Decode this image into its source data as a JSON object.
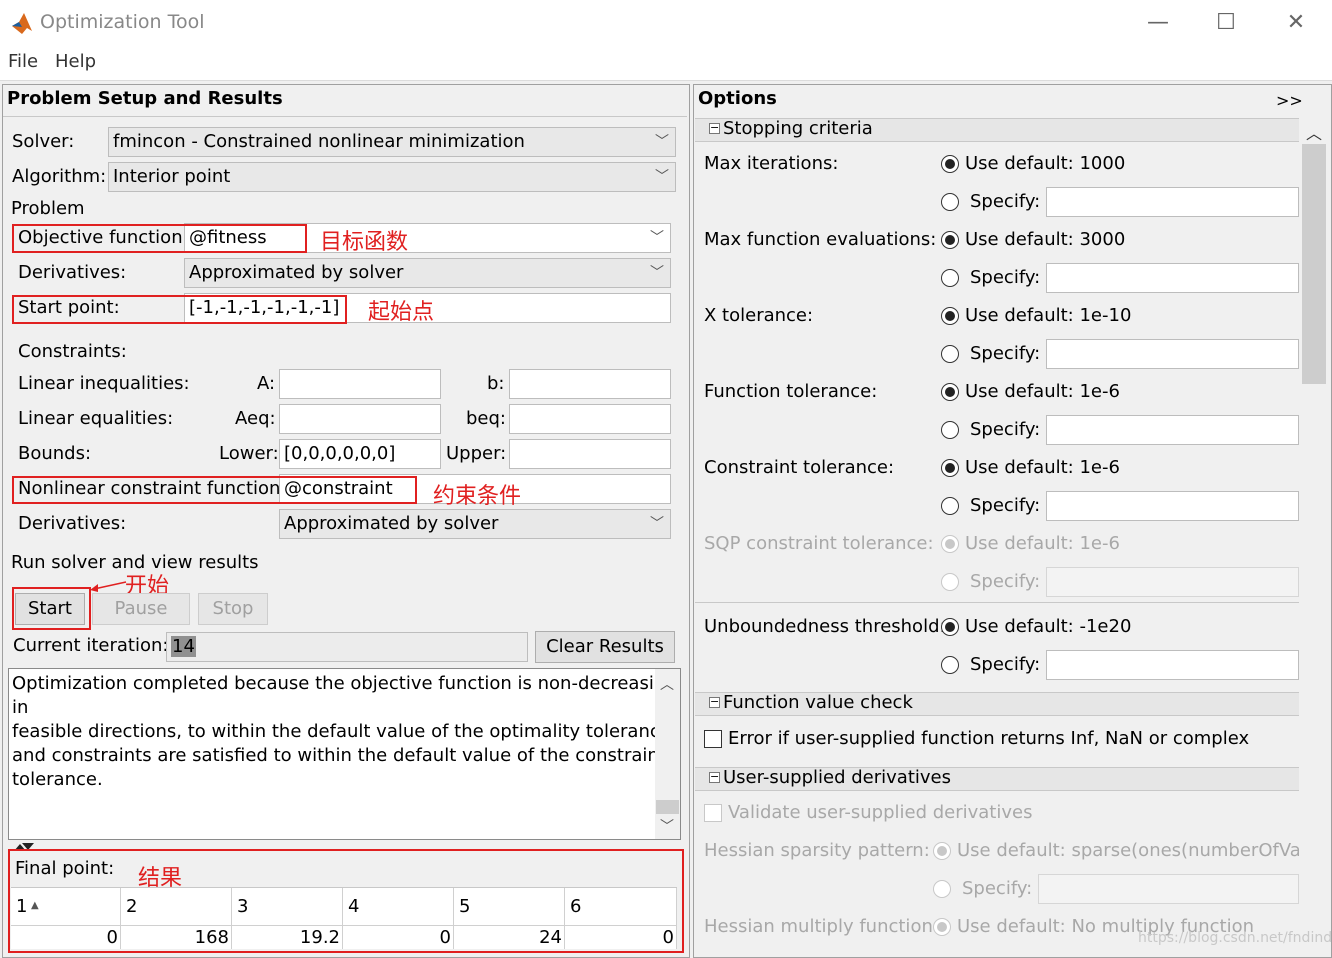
{
  "window": {
    "title": "Optimization Tool",
    "min": "—",
    "max": "☐",
    "close": "✕"
  },
  "menu": {
    "file": "File",
    "help": "Help"
  },
  "left": {
    "header": "Problem Setup and Results",
    "solver_label": "Solver:",
    "solver_value": "fmincon - Constrained nonlinear minimization",
    "algorithm_label": "Algorithm:",
    "algorithm_value": "Interior point",
    "problem_label": "Problem",
    "objective_label": "Objective function:",
    "objective_value": "@fitness",
    "objective_annotation": "目标函数",
    "derivatives_label": "Derivatives:",
    "derivatives_value": "Approximated by solver",
    "startpoint_label": "Start point:",
    "startpoint_value": "[-1,-1,-1,-1,-1,-1]",
    "startpoint_annotation": "起始点",
    "constraints_label": "Constraints:",
    "lin_ineq_label": "Linear inequalities:",
    "a_label": "A:",
    "b_label": "b:",
    "lin_eq_label": "Linear equalities:",
    "aeq_label": "Aeq:",
    "beq_label": "beq:",
    "bounds_label": "Bounds:",
    "lower_label": "Lower:",
    "lower_value": "[0,0,0,0,0,0]",
    "upper_label": "Upper:",
    "nonlin_label": "Nonlinear constraint function:",
    "nonlin_value": "@constraint",
    "nonlin_annotation": "约束条件",
    "derivatives2_label": "Derivatives:",
    "derivatives2_value": "Approximated by solver",
    "run_label": "Run solver and view results",
    "start_annotation": "开始",
    "start_button": "Start",
    "pause_button": "Pause",
    "stop_button": "Stop",
    "iteration_label": "Current iteration:",
    "iteration_value": "14",
    "clear_button": "Clear Results",
    "message_line1": "Optimization completed because the objective function is non-decreasing",
    "message_line2": "in",
    "message_line3": "feasible directions, to within the default value of the optimality tolerance,",
    "message_line4": "and constraints are satisfied to within the default value of the constraint",
    "message_line5": "tolerance.",
    "final_label": "Final point:",
    "final_annotation": "结果",
    "final_columns": [
      "1",
      "2",
      "3",
      "4",
      "5",
      "6"
    ],
    "final_values": [
      "0",
      "168",
      "19.2",
      "0",
      "24",
      "0"
    ]
  },
  "right": {
    "header": "Options",
    "expand": ">>",
    "stopping": "Stopping criteria",
    "max_iter_label": "Max iterations:",
    "max_iter_default": "Use default: 1000",
    "max_fev_label": "Max function evaluations:",
    "max_fev_default": "Use default: 3000",
    "xtol_label": "X tolerance:",
    "xtol_default": "Use default: 1e-10",
    "ftol_label": "Function tolerance:",
    "ftol_default": "Use default: 1e-6",
    "ctol_label": "Constraint tolerance:",
    "ctol_default": "Use default: 1e-6",
    "sqp_label": "SQP constraint tolerance:",
    "sqp_default": "Use default: 1e-6",
    "unb_label": "Unboundedness threshold:",
    "unb_default": "Use default: -1e20",
    "specify": "Specify:",
    "fvc": "Function value check",
    "fvc_check": "Error if user-supplied function returns Inf, NaN or complex",
    "usd": "User-supplied derivatives",
    "validate": "Validate user-supplied derivatives",
    "hess_sp_label": "Hessian sparsity pattern:",
    "hess_sp_default": "Use default: sparse(ones(numberOfVaria",
    "hess_mult_label": "Hessian multiply function:",
    "hess_mult_default": "Use default: No multiply function",
    "watermark": "https://blog.csdn.net/fndind"
  }
}
